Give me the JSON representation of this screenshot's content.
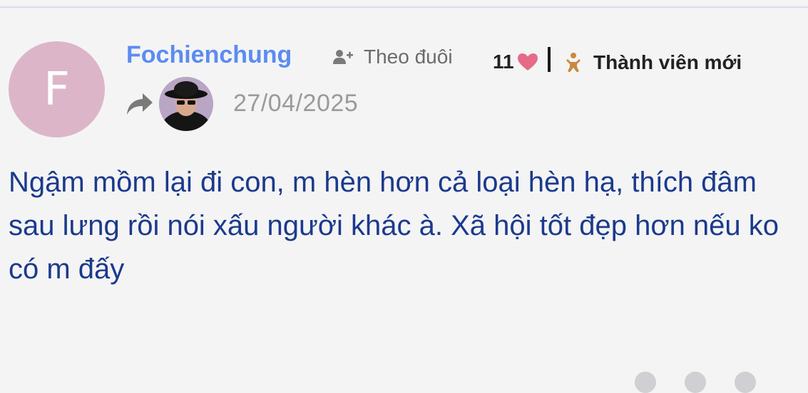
{
  "comment_card": {
    "author": {
      "initial": "F",
      "name": "Fochienchung",
      "avatar_color": "#dcb6c8",
      "name_color": "#5b8cf0"
    },
    "follow": {
      "icon": "user-plus-icon",
      "label": "Theo đuôi"
    },
    "likes": {
      "count": "11",
      "icon": "heart-icon",
      "color": "#e56b86"
    },
    "rank": {
      "icon": "baby-icon",
      "label": "Thành viên mới",
      "icon_color": "#c98a3e"
    },
    "reply_to": {
      "icon": "share-arrow-icon",
      "avatar": "quoted-user-avatar"
    },
    "date": "27/04/2025",
    "body": "Ngậm mồm lại đi con, m hèn hơn cả loại hèn hạ, thích đâm sau lưng rồi nói xấu người khác à. Xã hội tốt đẹp hơn nếu ko có m đấy",
    "body_color": "#1b3a8c"
  }
}
